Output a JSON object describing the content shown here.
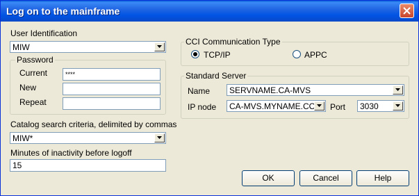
{
  "window": {
    "title": "Log on to the mainframe"
  },
  "user_identification": {
    "label": "User Identification",
    "value": "MIW"
  },
  "password": {
    "legend": "Password",
    "current_label": "Current",
    "current_value": "****",
    "new_label": "New",
    "new_value": "",
    "repeat_label": "Repeat",
    "repeat_value": ""
  },
  "catalog": {
    "label": "Catalog search criteria, delimited by commas",
    "value": "MIW*"
  },
  "inactivity": {
    "label": "Minutes of inactivity before logoff",
    "value": "15"
  },
  "cci": {
    "legend": "CCI Communication Type",
    "tcpip_label": "TCP/IP",
    "appc_label": "APPC",
    "selected": "TCP/IP"
  },
  "server": {
    "legend": "Standard Server",
    "name_label": "Name",
    "name_value": "SERVNAME.CA-MVS",
    "ipnode_label": "IP node",
    "ipnode_value": "CA-MVS.MYNAME.COM",
    "port_label": "Port",
    "port_value": "3030"
  },
  "buttons": {
    "ok": "OK",
    "cancel": "Cancel",
    "help": "Help"
  },
  "colors": {
    "titlebar": "#0054e3",
    "background": "#ece9d8",
    "close": "#c9452a"
  }
}
